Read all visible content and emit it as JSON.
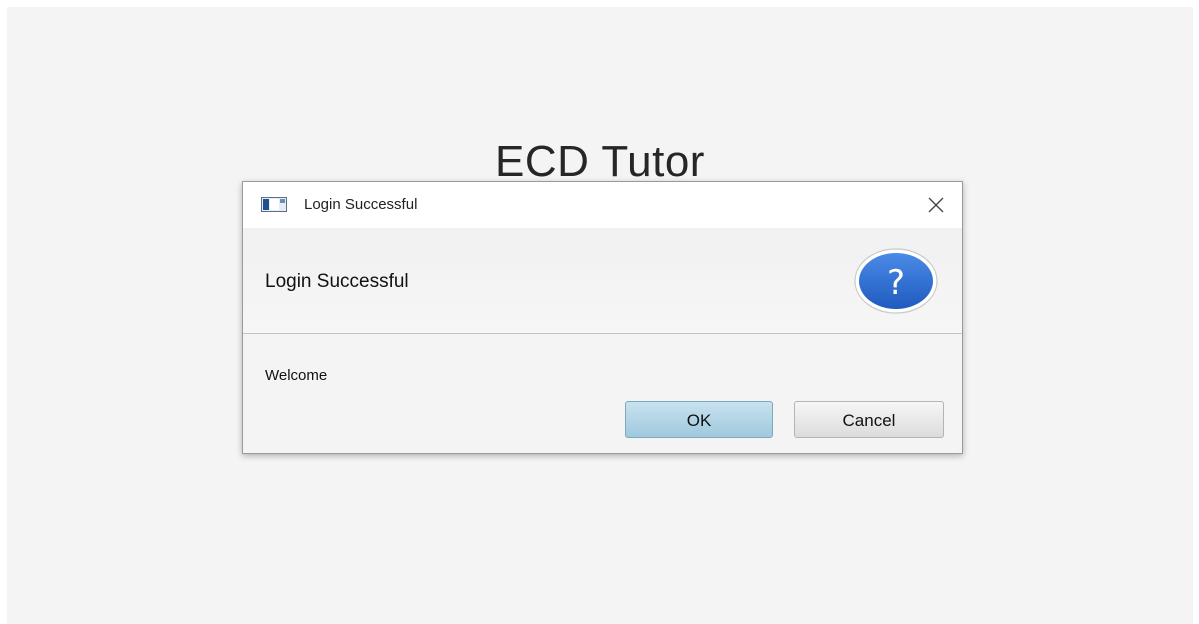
{
  "app": {
    "title": "ECD Tutor"
  },
  "dialog": {
    "window_title": "Login Successful",
    "header_text": "Login Successful",
    "header_icon": "question-icon",
    "content_text": "Welcome",
    "buttons": {
      "ok_label": "OK",
      "cancel_label": "Cancel"
    }
  },
  "colors": {
    "background": "#f4f4f4",
    "ok_button": "#b3d6e8",
    "question_icon": "#2f6fd1"
  }
}
